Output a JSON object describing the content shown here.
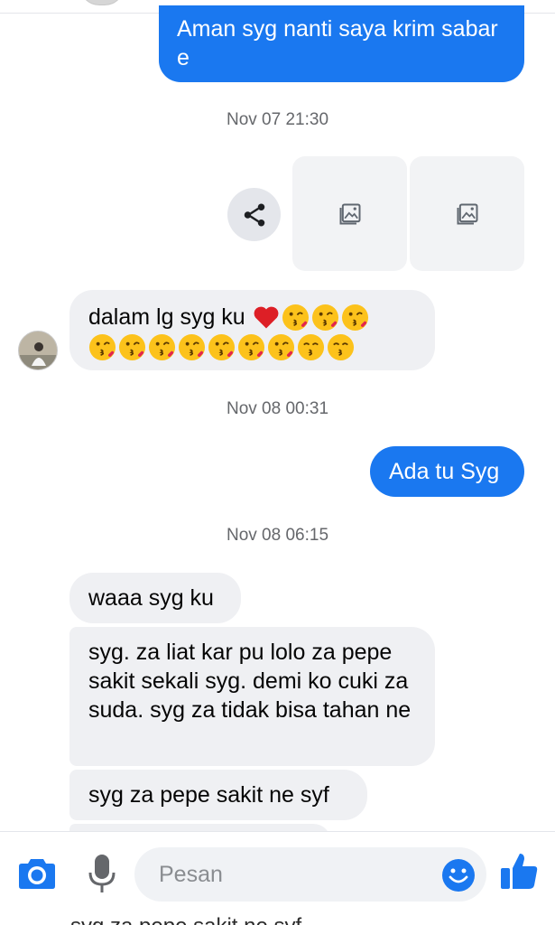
{
  "messages": {
    "out_1": "Aman syg nanti saya krim sabar e",
    "time_1": "Nov 07 21:30",
    "in_1_text": "dalam lg syg ku",
    "time_2": "Nov 08 00:31",
    "out_2": "Ada tu Syg",
    "time_3": "Nov 08 06:15",
    "in_2": "waaa syg ku",
    "in_3": "syg. za liat kar pu lolo za pepe sakit sekali syg. demi ko cuki za suda. syg za tidak bisa tahan ne",
    "in_4": "syg za pepe sakit ne syf",
    "peek": "syg za pepe sakit ne syf"
  },
  "composer": {
    "placeholder": "Pesan"
  },
  "icons": {
    "share": "share-icon",
    "image": "image-placeholder-icon",
    "camera": "camera-icon",
    "mic": "microphone-icon",
    "emoji": "emoji-icon",
    "like": "thumbs-up-icon"
  },
  "colors": {
    "accent": "#1a78f0",
    "incoming_bubble": "#eff0f3",
    "timestamp": "#65676b"
  }
}
